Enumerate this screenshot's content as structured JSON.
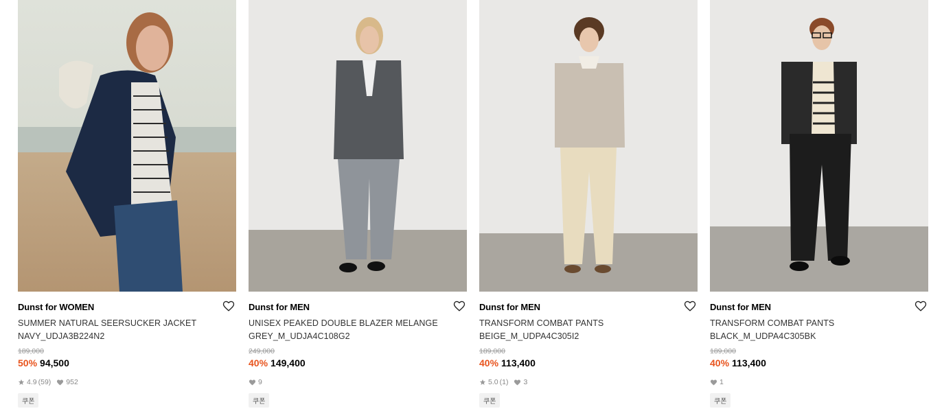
{
  "products": [
    {
      "brand": "Dunst for WOMEN",
      "name_line1": "SUMMER NATURAL SEERSUCKER JACKET",
      "name_line2": "NAVY_UDJA3B224N2",
      "original_price": "189,000",
      "discount": "50%",
      "price": "94,500",
      "rating": "4.9",
      "review_count": "(59)",
      "likes": "952",
      "coupon": "쿠폰"
    },
    {
      "brand": "Dunst for MEN",
      "name_line1": "UNISEX PEAKED DOUBLE BLAZER MELANGE",
      "name_line2": "GREY_M_UDJA4C108G2",
      "original_price": "249,000",
      "discount": "40%",
      "price": "149,400",
      "likes": "9",
      "coupon": "쿠폰"
    },
    {
      "brand": "Dunst for MEN",
      "name_line1": "TRANSFORM COMBAT PANTS",
      "name_line2": "BEIGE_M_UDPA4C305I2",
      "original_price": "189,000",
      "discount": "40%",
      "price": "113,400",
      "rating": "5.0",
      "review_count": "(1)",
      "likes": "3",
      "coupon": "쿠폰"
    },
    {
      "brand": "Dunst for MEN",
      "name_line1": "TRANSFORM COMBAT PANTS",
      "name_line2": "BLACK_M_UDPA4C305BK",
      "original_price": "189,000",
      "discount": "40%",
      "price": "113,400",
      "likes": "1",
      "coupon": "쿠폰"
    }
  ],
  "colors": {
    "discount": "#e8541e",
    "muted": "#888888",
    "coupon_bg": "#f1f1f1"
  },
  "icons": [
    "heart-outline-icon",
    "star-icon",
    "heart-filled-icon"
  ]
}
